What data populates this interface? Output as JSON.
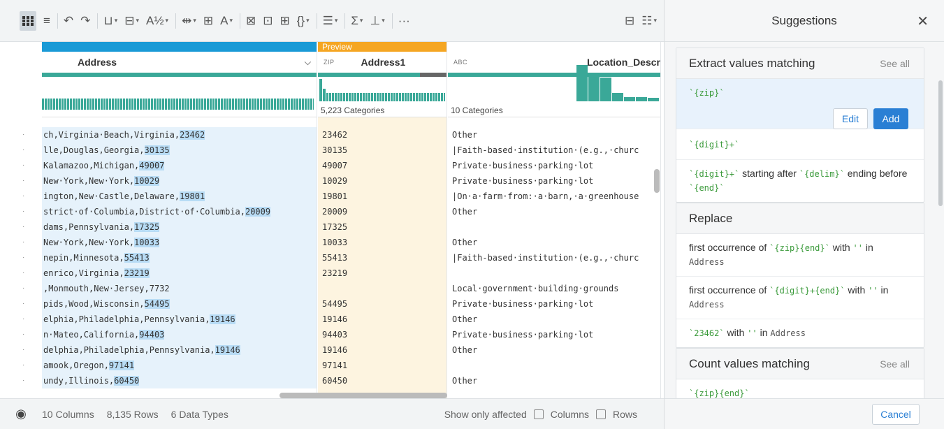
{
  "toolbar": {
    "icons": [
      "grid-view-icon",
      "list-view-icon",
      "undo-icon",
      "redo-icon",
      "column-type-icon",
      "split-icon",
      "rename-icon",
      "move-icon",
      "merge-icon",
      "text-format-icon",
      "nest-icon",
      "unnest-icon",
      "pivot-icon",
      "json-icon",
      "filter-icon",
      "aggregate-icon",
      "restructure-icon",
      "more-icon",
      "table-icon",
      "settings-icon"
    ],
    "more_label": "···"
  },
  "grid": {
    "columns": [
      {
        "name": "Address",
        "type": "",
        "strip_color": "#1a9ad6"
      },
      {
        "name": "Address1",
        "type": "ZIP",
        "strip_label": "Preview",
        "strip_color": "#f5a623",
        "categories": "5,223 Categories"
      },
      {
        "name": "Location_Descr",
        "type": "ABC",
        "categories": "10 Categories"
      }
    ],
    "rows": [
      {
        "addr_pre": "ch,Virginia·Beach,Virginia,",
        "addr_hl": "23462",
        "zip": "23462",
        "loc": "Other"
      },
      {
        "addr_pre": "lle,Douglas,Georgia,",
        "addr_hl": "30135",
        "zip": "30135",
        "loc": "|Faith-based·institution·(e.g.,·churc"
      },
      {
        "addr_pre": "Kalamazoo,Michigan,",
        "addr_hl": "49007",
        "zip": "49007",
        "loc": "Private·business·parking·lot"
      },
      {
        "addr_pre": "New·York,New·York,",
        "addr_hl": "10029",
        "zip": "10029",
        "loc": "Private·business·parking·lot"
      },
      {
        "addr_pre": "ington,New·Castle,Delaware,",
        "addr_hl": "19801",
        "zip": "19801",
        "loc": "|On·a·farm·from:·a·barn,·a·greenhouse"
      },
      {
        "addr_pre": "strict·of·Columbia,District·of·Columbia,",
        "addr_hl": "20009",
        "zip": "20009",
        "loc": "Other"
      },
      {
        "addr_pre": "dams,Pennsylvania,",
        "addr_hl": "17325",
        "zip": "17325",
        "loc": ""
      },
      {
        "addr_pre": "New·York,New·York,",
        "addr_hl": "10033",
        "zip": "10033",
        "loc": "Other"
      },
      {
        "addr_pre": "nepin,Minnesota,",
        "addr_hl": "55413",
        "zip": "55413",
        "loc": "|Faith-based·institution·(e.g.,·churc"
      },
      {
        "addr_pre": "enrico,Virginia,",
        "addr_hl": "23219",
        "zip": "23219",
        "loc": ""
      },
      {
        "addr_pre": ",Monmouth,New·Jersey,7732",
        "addr_hl": "",
        "zip": "",
        "loc": "Local·government·building·grounds"
      },
      {
        "addr_pre": "pids,Wood,Wisconsin,",
        "addr_hl": "54495",
        "zip": "54495",
        "loc": "Private·business·parking·lot"
      },
      {
        "addr_pre": "elphia,Philadelphia,Pennsylvania,",
        "addr_hl": "19146",
        "zip": "19146",
        "loc": "Other"
      },
      {
        "addr_pre": "n·Mateo,California,",
        "addr_hl": "94403",
        "zip": "94403",
        "loc": "Private·business·parking·lot"
      },
      {
        "addr_pre": "delphia,Philadelphia,Pennsylvania,",
        "addr_hl": "19146",
        "zip": "19146",
        "loc": "Other"
      },
      {
        "addr_pre": "amook,Oregon,",
        "addr_hl": "97141",
        "zip": "97141",
        "loc": ""
      },
      {
        "addr_pre": "undy,Illinois,",
        "addr_hl": "60450",
        "zip": "60450",
        "loc": "Other"
      }
    ]
  },
  "status": {
    "columns": "10 Columns",
    "rows": "8,135 Rows",
    "types": "6 Data Types",
    "show_only": "Show only affected",
    "columns_chk": "Columns",
    "rows_chk": "Rows"
  },
  "panel": {
    "title": "Suggestions",
    "extract": {
      "title": "Extract values matching",
      "see_all": "See all",
      "s1_tok": "`{zip}`",
      "edit": "Edit",
      "add": "Add",
      "s2_tok": "`{digit}+`",
      "s3_tok1": "`{digit}+`",
      "s3_t1": " starting after ",
      "s3_tok2": "`{delim}`",
      "s3_t2": " ending before ",
      "s3_tok3": "`{end}`"
    },
    "replace": {
      "title": "Replace",
      "r1_pre": "first occurrence of ",
      "r1_tok": "`{zip}{end}`",
      "r1_mid": " with ",
      "r1_tok2": "''",
      "r1_in": " in",
      "r1_col": "Address",
      "r2_pre": "first occurrence of ",
      "r2_tok": "`{digit}+{end}`",
      "r2_mid": " with ",
      "r2_tok2": "''",
      "r2_in": " in",
      "r2_col": "Address",
      "r3_tok": "`23462`",
      "r3_mid": " with ",
      "r3_tok2": "''",
      "r3_in": " in ",
      "r3_col": "Address"
    },
    "count": {
      "title": "Count values matching",
      "see_all": "See all",
      "c1_tok": "`{zip}{end}`"
    },
    "cancel": "Cancel"
  }
}
